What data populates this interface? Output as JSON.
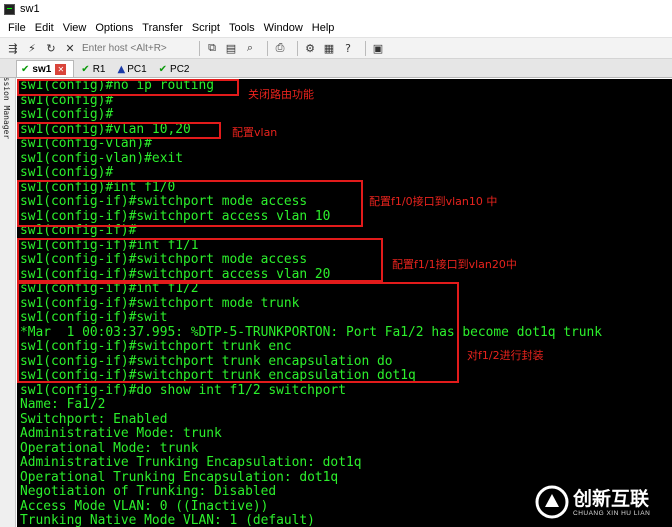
{
  "window": {
    "title": "sw1"
  },
  "menu": [
    {
      "label": "File",
      "key": "file"
    },
    {
      "label": "Edit",
      "key": "edit"
    },
    {
      "label": "View",
      "key": "view"
    },
    {
      "label": "Options",
      "key": "options"
    },
    {
      "label": "Transfer",
      "key": "transfer"
    },
    {
      "label": "Script",
      "key": "script"
    },
    {
      "label": "Tools",
      "key": "tools"
    },
    {
      "label": "Window",
      "key": "window"
    },
    {
      "label": "Help",
      "key": "help"
    }
  ],
  "toolbar": {
    "host_placeholder": "Enter host <Alt+R>",
    "icons": [
      "connect-icon",
      "quick-connect-icon",
      "reconnect-icon",
      "disconnect-icon",
      "copy-icon",
      "paste-icon",
      "find-icon",
      "print-icon",
      "settings-icon",
      "keymap-icon",
      "help-icon",
      "sftp-icon"
    ]
  },
  "sidebar": {
    "label": "Session Manager"
  },
  "tabs": [
    {
      "label": "sw1",
      "status": "connected",
      "active": true,
      "closable": true
    },
    {
      "label": "R1",
      "status": "connected",
      "active": false
    },
    {
      "label": "PC1",
      "status": "warning",
      "active": false
    },
    {
      "label": "PC2",
      "status": "connected",
      "active": false
    }
  ],
  "terminal": {
    "text_color": "#2cf02c",
    "lines": [
      "sw1(config)#no ip routing",
      "sw1(config)#",
      "sw1(config)#",
      "sw1(config)#vlan 10,20",
      "sw1(config-vlan)#",
      "sw1(config-vlan)#exit",
      "sw1(config)#",
      "sw1(config)#int f1/0",
      "sw1(config-if)#switchport mode access",
      "sw1(config-if)#switchport access vlan 10",
      "sw1(config-if)#",
      "sw1(config-if)#int f1/1",
      "sw1(config-if)#switchport mode access",
      "sw1(config-if)#switchport access vlan 20",
      "sw1(config-if)#int f1/2",
      "sw1(config-if)#switchport mode trunk",
      "sw1(config-if)#swit",
      "*Mar  1 00:03:37.995: %DTP-5-TRUNKPORTON: Port Fa1/2 has become dot1q trunk",
      "sw1(config-if)#switchport trunk enc",
      "sw1(config-if)#switchport trunk encapsulation do",
      "sw1(config-if)#switchport trunk encapsulation dot1q",
      "sw1(config-if)#do show int f1/2 switchport",
      "Name: Fa1/2",
      "Switchport: Enabled",
      "Administrative Mode: trunk",
      "Operational Mode: trunk",
      "Administrative Trunking Encapsulation: dot1q",
      "Operational Trunking Encapsulation: dot1q",
      "Negotiation of Trunking: Disabled",
      "Access Mode VLAN: 0 ((Inactive))",
      "Trunking Native Mode VLAN: 1 (default)"
    ]
  },
  "annotations": [
    {
      "text": "关闭路由功能",
      "color": "#e8231d"
    },
    {
      "text": "配置vlan",
      "color": "#e8231d"
    },
    {
      "text": "配置f1/0接口到vlan10 中",
      "color": "#e8231d"
    },
    {
      "text": "配置f1/1接口到vlan20中",
      "color": "#e8231d"
    },
    {
      "text": "对f1/2进行封装",
      "color": "#e8231d"
    }
  ],
  "watermark": {
    "cn": "创新互联",
    "en": "CHUANG XIN HU LIAN"
  }
}
